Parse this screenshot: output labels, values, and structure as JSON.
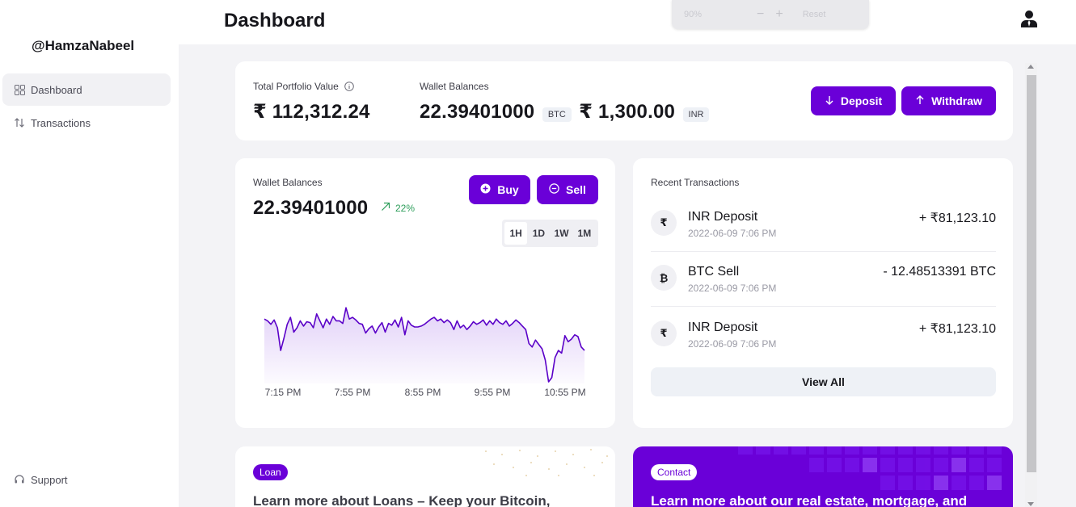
{
  "app": {
    "title": "Dashboard",
    "username": "@HamzaNabeel"
  },
  "sidebar": {
    "items": [
      {
        "label": "Dashboard",
        "icon": "grid-icon",
        "active": true
      },
      {
        "label": "Transactions",
        "icon": "arrows-updown-icon",
        "active": false
      }
    ],
    "support_label": "Support"
  },
  "zoom": {
    "level": "90%",
    "minus": "−",
    "plus": "+",
    "reset": "Reset"
  },
  "portfolio": {
    "total_label": "Total Portfolio Value",
    "total_value": "₹ 112,312.24",
    "wallet_label": "Wallet Balances",
    "btc_value": "22.39401000",
    "btc_unit": "BTC",
    "inr_value": "₹ 1,300.00",
    "inr_unit": "INR",
    "deposit_label": "Deposit",
    "withdraw_label": "Withdraw"
  },
  "chart_card": {
    "label": "Wallet Balances",
    "value": "22.39401000",
    "change": "22%",
    "buy_label": "Buy",
    "sell_label": "Sell",
    "timeframes": [
      "1H",
      "1D",
      "1W",
      "1M"
    ],
    "active_timeframe": "1H",
    "accent": "#6a00d8"
  },
  "chart_data": {
    "type": "area",
    "title": "",
    "xlabel": "",
    "ylabel": "",
    "x_ticks": [
      "7:15 PM",
      "7:55 PM",
      "8:55 PM",
      "9:55 PM",
      "10:55 PM"
    ],
    "grid": false,
    "series": [
      {
        "values": [
          0.72,
          0.7,
          0.66,
          0.71,
          0.62,
          0.36,
          0.5,
          0.66,
          0.74,
          0.57,
          0.62,
          0.7,
          0.64,
          0.69,
          0.68,
          0.62,
          0.78,
          0.7,
          0.62,
          0.72,
          0.66,
          0.75,
          0.7,
          0.7,
          0.67,
          0.85,
          0.72,
          0.74,
          0.71,
          0.67,
          0.66,
          0.56,
          0.61,
          0.64,
          0.56,
          0.63,
          0.68,
          0.57,
          0.67,
          0.65,
          0.71,
          0.63,
          0.74,
          0.54,
          0.7,
          0.65,
          0.63,
          0.63,
          0.64,
          0.66,
          0.69,
          0.72,
          0.74,
          0.7,
          0.72,
          0.68,
          0.71,
          0.68,
          0.6,
          0.7,
          0.62,
          0.65,
          0.6,
          0.64,
          0.69,
          0.66,
          0.68,
          0.71,
          0.65,
          0.7,
          0.66,
          0.72,
          0.68,
          0.66,
          0.7,
          0.64,
          0.67,
          0.71,
          0.68,
          0.64,
          0.6,
          0.44,
          0.4,
          0.48,
          0.43,
          0.38,
          0.25,
          0.0,
          0.05,
          0.28,
          0.36,
          0.33,
          0.53,
          0.46,
          0.49,
          0.54,
          0.52,
          0.4,
          0.36
        ]
      }
    ]
  },
  "recent": {
    "title": "Recent Transactions",
    "rows": [
      {
        "icon": "rupee-icon",
        "glyph": "₹",
        "name": "INR Deposit",
        "date": "2022-06-09 7:06 PM",
        "amount": "+ ₹81,123.10"
      },
      {
        "icon": "bitcoin-icon",
        "glyph": "₿",
        "name": "BTC Sell",
        "date": "2022-06-09 7:06 PM",
        "amount": "- 12.48513391 BTC"
      },
      {
        "icon": "rupee-icon",
        "glyph": "₹",
        "name": "INR Deposit",
        "date": "2022-06-09 7:06 PM",
        "amount": "+ ₹81,123.10"
      }
    ],
    "view_all_label": "View All"
  },
  "promo": {
    "loan_badge": "Loan",
    "loan_text": "Learn more about Loans – Keep your Bitcoin,",
    "contact_badge": "Contact",
    "contact_text": "Learn more about our real estate, mortgage, and"
  }
}
